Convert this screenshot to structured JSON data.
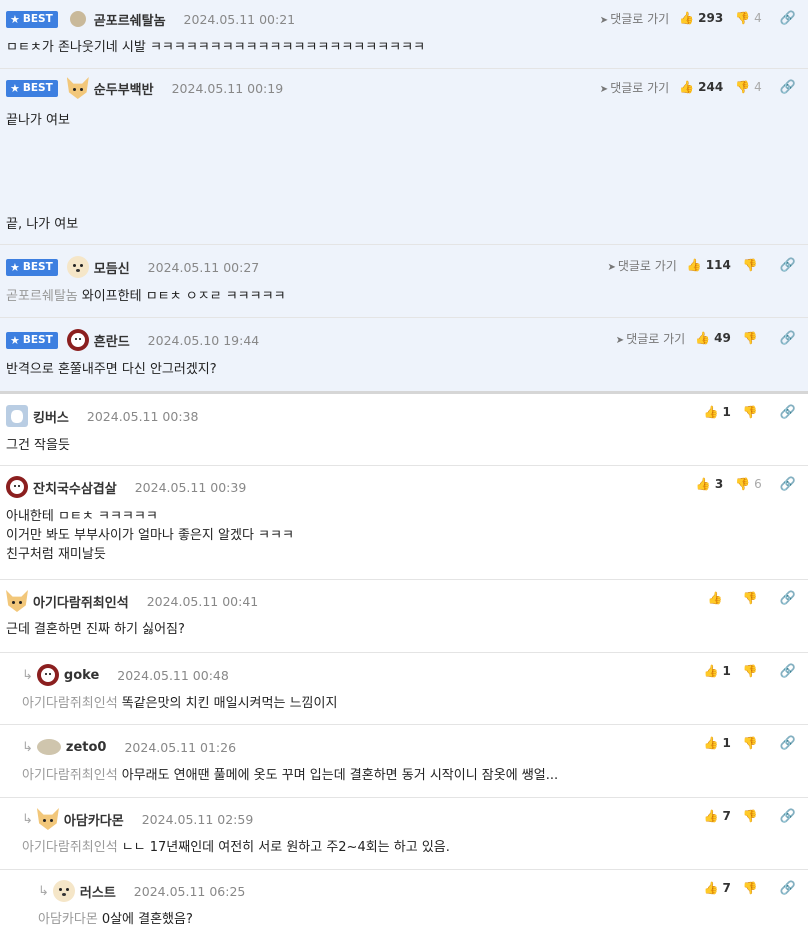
{
  "labels": {
    "best": "BEST",
    "goto": "댓글로 가기"
  },
  "comments": [
    {
      "nick": "곧포르쉐탈놈",
      "date": "2024.05.11 00:21",
      "likes": "293",
      "dislikes": "4",
      "body": [
        "ㅁㅌㅊ가 존나웃기네 시발 ㅋㅋㅋㅋㅋㅋㅋㅋㅋㅋㅋㅋㅋㅋㅋㅋㅋㅋㅋㅋㅋㅋㅋ"
      ]
    },
    {
      "nick": "순두부백반",
      "date": "2024.05.11 00:19",
      "likes": "244",
      "dislikes": "4",
      "body": [
        "끝나가 여보",
        "끝, 나가 여보"
      ]
    },
    {
      "nick": "모듬신",
      "date": "2024.05.11 00:27",
      "likes": "114",
      "mention": "곧포르쉐탈놈",
      "body": [
        "와이프한테 ㅁㅌㅊ ㅇㅈㄹ ㅋㅋㅋㅋㅋ"
      ]
    },
    {
      "nick": "흔란드",
      "date": "2024.05.10 19:44",
      "likes": "49",
      "body": [
        "반격으로 혼쭐내주면 다신 안그러겠지?"
      ]
    },
    {
      "nick": "킹버스",
      "date": "2024.05.11 00:38",
      "likes": "1",
      "body": [
        "그건 작을듯"
      ]
    },
    {
      "nick": "잔치국수삼겹살",
      "date": "2024.05.11 00:39",
      "likes": "3",
      "dislikes": "6",
      "body": [
        "아내한테 ㅁㅌㅊ ㅋㅋㅋㅋㅋ",
        "이거만 봐도 부부사이가 얼마나 좋은지 알겠다 ㅋㅋㅋ",
        "친구처럼 재미날듯"
      ]
    },
    {
      "nick": "아기다람쥐최인석",
      "date": "2024.05.11 00:41",
      "body": [
        "근데 결혼하면 진짜 하기 싫어짐?"
      ]
    },
    {
      "nick": "goke",
      "date": "2024.05.11 00:48",
      "likes": "1",
      "mention": "아기다람쥐최인석",
      "body": [
        "똑같은맛의 치킨 매일시켜먹는 느낌이지"
      ]
    },
    {
      "nick": "zeto0",
      "date": "2024.05.11 01:26",
      "likes": "1",
      "mention": "아기다람쥐최인석",
      "body": [
        "아무래도 연애땐 풀메에 옷도 꾸며 입는데 결혼하면 동거 시작이니 잠옷에 쌩얼..."
      ]
    },
    {
      "nick": "아담카다몬",
      "date": "2024.05.11 02:59",
      "likes": "7",
      "mention": "아기다람쥐최인석",
      "body": [
        "ㄴㄴ 17년째인데 여전히 서로 원하고 주2~4회는 하고 있음."
      ]
    },
    {
      "nick": "러스트",
      "date": "2024.05.11 06:25",
      "likes": "7",
      "mention": "아담카다몬",
      "body": [
        "0살에 결혼했음?"
      ]
    }
  ]
}
